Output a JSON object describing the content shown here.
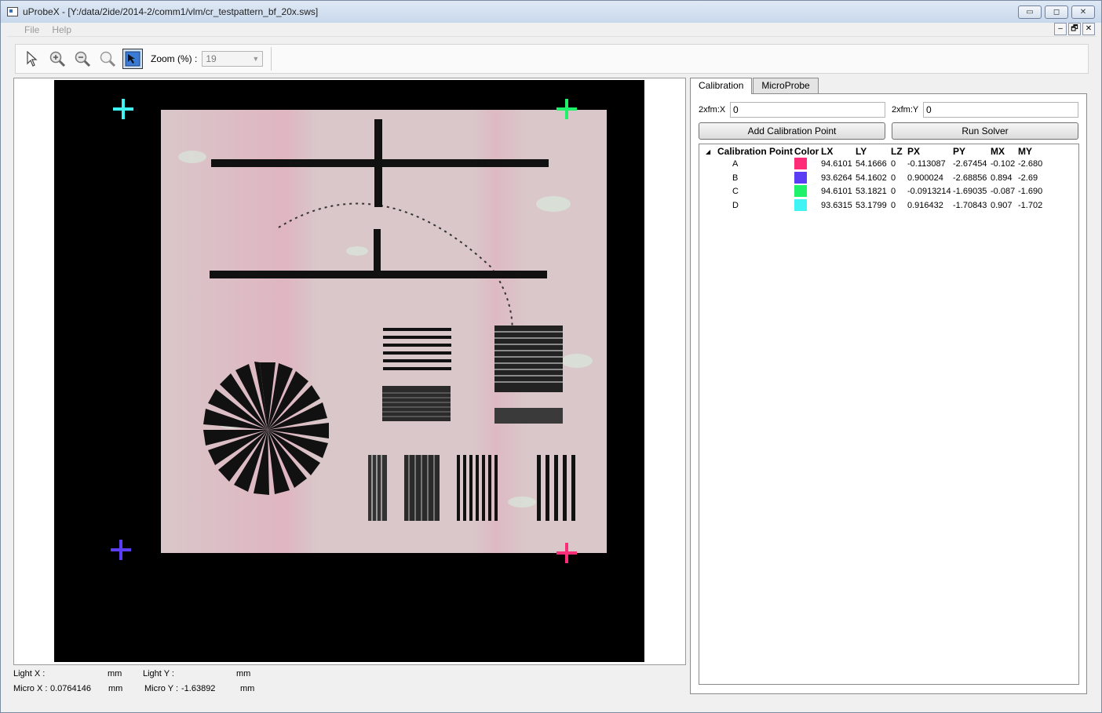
{
  "window": {
    "title": "uProbeX - [Y:/data/2ide/2014-2/comm1/vlm/cr_testpattern_bf_20x.sws]",
    "caption_buttons": [
      "▭",
      "◻",
      "✕"
    ]
  },
  "menu": {
    "items": [
      "File",
      "Help"
    ],
    "mdi_buttons": [
      "–",
      "🗗",
      "✕"
    ]
  },
  "toolbar": {
    "tools": [
      "pointer-icon",
      "zoom-in-icon",
      "zoom-out-icon",
      "zoom-fit-icon",
      "calibration-tool-icon"
    ],
    "zoom_label": "Zoom (%) :",
    "zoom_value": "19"
  },
  "status": {
    "light_x_label": "Light X :",
    "light_x_value": "",
    "light_x_unit": "mm",
    "light_y_label": "Light Y :",
    "light_y_value": "",
    "light_y_unit": "mm",
    "micro_x_label": "Micro X :",
    "micro_x_value": "0.0764146",
    "micro_x_unit": "mm",
    "micro_y_label": "Micro Y :",
    "micro_y_value": "-1.63892",
    "micro_y_unit": "mm"
  },
  "panel": {
    "tabs": [
      "Calibration",
      "MicroProbe"
    ],
    "xfm_x_label": "2xfm:X",
    "xfm_x_value": "0",
    "xfm_y_label": "2xfm:Y",
    "xfm_y_value": "0",
    "add_button": "Add Calibration Point",
    "solver_button": "Run Solver"
  },
  "table": {
    "expander": "◢",
    "columns": [
      "Calibration Point",
      "Color",
      "LX",
      "LY",
      "LZ",
      "PX",
      "PY",
      "MX",
      "MY"
    ],
    "rows": [
      {
        "name": "A",
        "color": "#ff2d78",
        "lx": "94.6101",
        "ly": "54.1666",
        "lz": "0",
        "px": "-0.113087",
        "py": "-2.67454",
        "mx": "-0.102",
        "my": "-2.680"
      },
      {
        "name": "B",
        "color": "#5b3df5",
        "lx": "93.6264",
        "ly": "54.1602",
        "lz": "0",
        "px": "0.900024",
        "py": "-2.68856",
        "mx": "0.894",
        "my": "-2.69"
      },
      {
        "name": "C",
        "color": "#1ff26a",
        "lx": "94.6101",
        "ly": "53.1821",
        "lz": "0",
        "px": "-0.0913214",
        "py": "-1.69035",
        "mx": "-0.087",
        "my": "-1.690"
      },
      {
        "name": "D",
        "color": "#41f4f4",
        "lx": "93.6315",
        "ly": "53.1799",
        "lz": "0",
        "px": "0.916432",
        "py": "-1.70843",
        "mx": "0.907",
        "my": "-1.702"
      }
    ]
  },
  "markers": {
    "A": "#ff2d78",
    "B": "#5b3df5",
    "C": "#1ff26a",
    "D": "#41f4f4"
  }
}
